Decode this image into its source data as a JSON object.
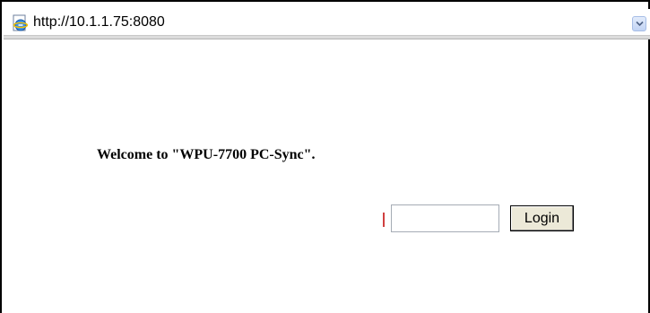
{
  "browser": {
    "address": "http://10.1.1.75:8080",
    "page_icon": "ie-page-icon",
    "dropdown_icon": "chevron-down-icon"
  },
  "main": {
    "welcome_text": "Welcome to \"WPU-7700 PC-Sync\".",
    "login_field_value": "",
    "login_button_label": "Login"
  },
  "colors": {
    "page_background": "#ffffff",
    "button_face": "#ece9d8",
    "field_marker": "#d04040"
  }
}
